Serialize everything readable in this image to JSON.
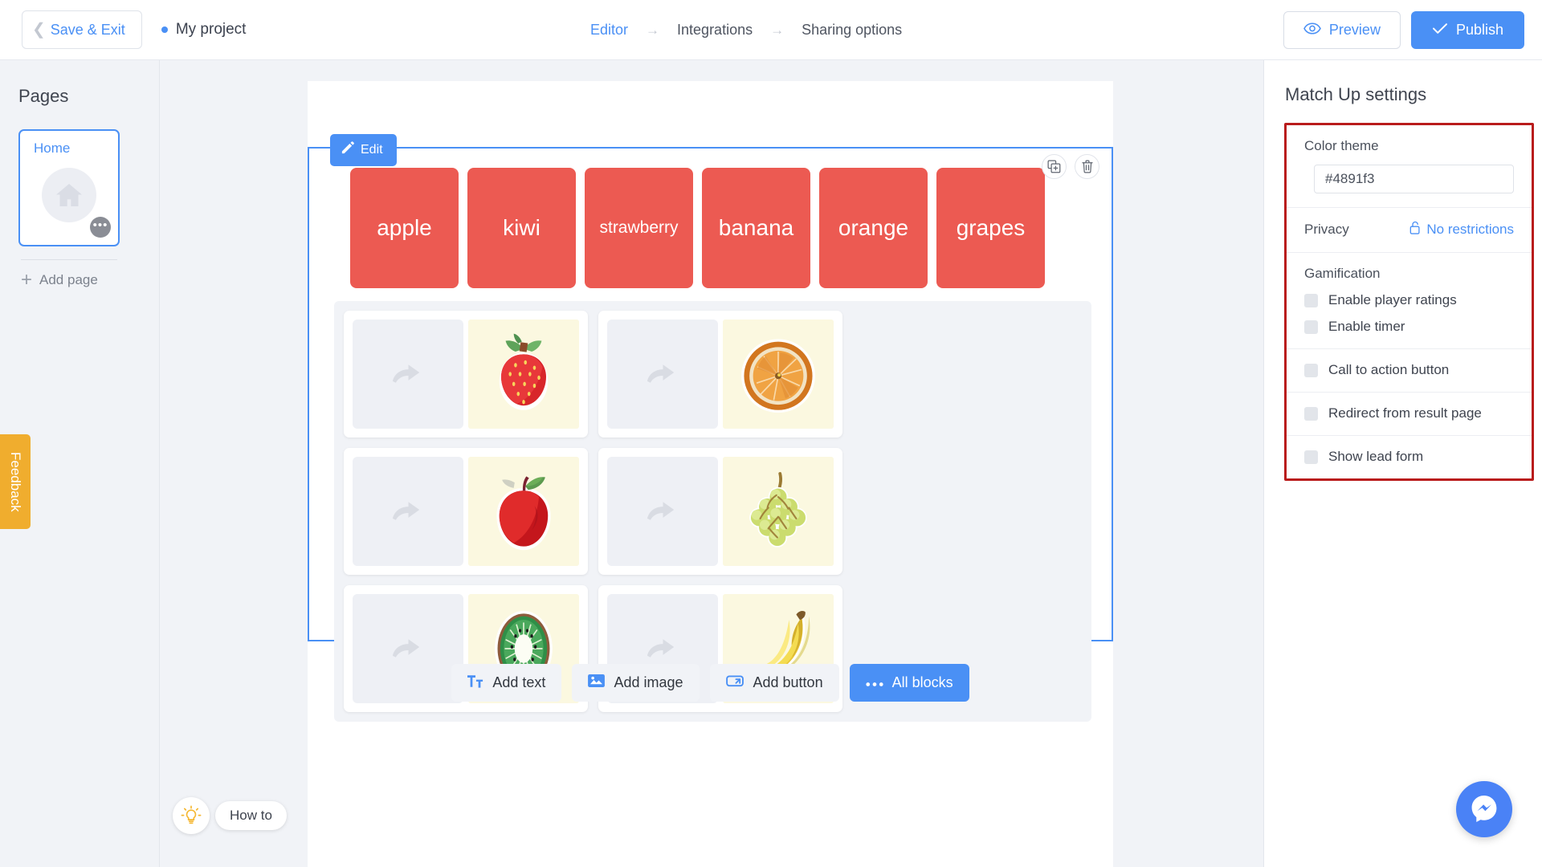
{
  "topbar": {
    "save_exit": "Save & Exit",
    "project_name": "My project",
    "breadcrumbs": [
      {
        "label": "Editor",
        "active": true
      },
      {
        "label": "Integrations",
        "active": false
      },
      {
        "label": "Sharing options",
        "active": false
      }
    ],
    "crumb_arrow": "→",
    "preview": "Preview",
    "publish": "Publish",
    "icons": {
      "back_chevron": "chevron-left-icon",
      "eye": "eye-icon",
      "check": "check-icon",
      "project_dot": "status-dot-icon"
    }
  },
  "sidebar": {
    "title": "Pages",
    "pages": [
      {
        "label": "Home",
        "icon": "home-icon",
        "selected": true,
        "menu": "•••"
      }
    ],
    "add_page": "Add page",
    "add_page_icon": "plus-icon",
    "feedback": "Feedback",
    "feedback_color": "#f0ad2e",
    "how_to": "How to",
    "how_to_icon": "lightbulb-icon"
  },
  "canvas": {
    "block": {
      "edit_label": "Edit",
      "edit_icon": "pencil-icon",
      "tools": [
        {
          "name": "duplicate-icon",
          "title": "Duplicate"
        },
        {
          "name": "delete-icon",
          "title": "Delete"
        }
      ],
      "word_color": "#ec5a52",
      "words": [
        {
          "label": "apple",
          "small": false
        },
        {
          "label": "kiwi",
          "small": false
        },
        {
          "label": "strawberry",
          "small": true
        },
        {
          "label": "banana",
          "small": false
        },
        {
          "label": "orange",
          "small": false
        },
        {
          "label": "grapes",
          "small": false
        }
      ],
      "pairs": [
        {
          "image": "strawberry-image",
          "drop_icon": "curved-arrow-icon"
        },
        {
          "image": "orange-image",
          "drop_icon": "curved-arrow-icon"
        },
        {
          "image": "apple-image",
          "drop_icon": "curved-arrow-icon"
        },
        {
          "image": "grapes-image",
          "drop_icon": "curved-arrow-icon"
        },
        {
          "image": "kiwi-image",
          "drop_icon": "curved-arrow-icon"
        },
        {
          "image": "banana-image",
          "drop_icon": "curved-arrow-icon"
        }
      ]
    },
    "addbar": [
      {
        "label": "Add text",
        "icon": "text-icon",
        "primary": false
      },
      {
        "label": "Add image",
        "icon": "image-icon",
        "primary": false
      },
      {
        "label": "Add button",
        "icon": "button-icon",
        "primary": false
      },
      {
        "label": "All blocks",
        "icon": "ellipsis-icon",
        "primary": true
      }
    ]
  },
  "settings": {
    "title": "Match Up settings",
    "highlight_color": "#b91c1c",
    "color_theme": {
      "label": "Color theme",
      "value": "#4891f3",
      "swatch": "#5b8ef0"
    },
    "privacy": {
      "label": "Privacy",
      "value": "No restrictions",
      "icon": "unlock-icon"
    },
    "gamification": {
      "label": "Gamification",
      "options": [
        {
          "label": "Enable player ratings",
          "checked": false
        },
        {
          "label": "Enable timer",
          "checked": false
        }
      ]
    },
    "toggles": [
      {
        "label": "Call to action button",
        "checked": false
      },
      {
        "label": "Redirect from result page",
        "checked": false
      },
      {
        "label": "Show lead form",
        "checked": false
      }
    ]
  },
  "messenger": {
    "icon": "messenger-icon",
    "color": "#4a82f6"
  }
}
